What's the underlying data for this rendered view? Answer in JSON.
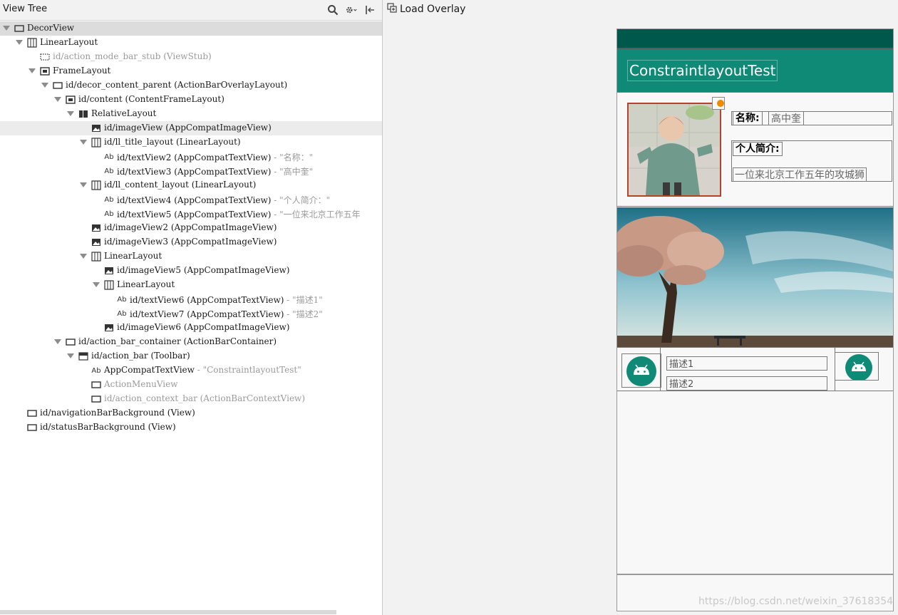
{
  "tree_panel": {
    "title": "View Tree",
    "icons": [
      "search-icon",
      "gear-icon",
      "collapse-icon"
    ]
  },
  "rows": [
    {
      "name": "DecorView",
      "id": "",
      "suffix": "",
      "icon": "frame",
      "arrow": true,
      "dim": false
    },
    {
      "name": "LinearLayout",
      "id": "",
      "suffix": "",
      "icon": "linear",
      "arrow": true,
      "dim": false
    },
    {
      "name": "id/action_mode_bar_stub (ViewStub)",
      "id": "",
      "suffix": "",
      "icon": "stub",
      "arrow": false,
      "dim": true
    },
    {
      "name": "FrameLayout",
      "id": "",
      "suffix": "",
      "icon": "framelayout",
      "arrow": true,
      "dim": false
    },
    {
      "name": "id/decor_content_parent (ActionBarOverlayLayout)",
      "id": "",
      "suffix": "",
      "icon": "frame",
      "arrow": true,
      "dim": false
    },
    {
      "name": "id/content (ContentFrameLayout)",
      "id": "",
      "suffix": "",
      "icon": "framelayout",
      "arrow": true,
      "dim": false
    },
    {
      "name": "RelativeLayout",
      "id": "",
      "suffix": "",
      "icon": "relative",
      "arrow": true,
      "dim": false
    },
    {
      "name": "id/imageView (AppCompatImageView)",
      "id": "",
      "suffix": "",
      "icon": "image",
      "arrow": false,
      "dim": false
    },
    {
      "name": "id/ll_title_layout (LinearLayout)",
      "id": "",
      "suffix": "",
      "icon": "linear",
      "arrow": true,
      "dim": false
    },
    {
      "name": "id/textView2 (AppCompatTextView)",
      "id": "",
      "suffix": " - \"名称：\"",
      "icon": "text",
      "arrow": false,
      "dim": false
    },
    {
      "name": "id/textView3 (AppCompatTextView)",
      "id": "",
      "suffix": " - \"高中奎\"",
      "icon": "text",
      "arrow": false,
      "dim": false
    },
    {
      "name": "id/ll_content_layout (LinearLayout)",
      "id": "",
      "suffix": "",
      "icon": "linear",
      "arrow": true,
      "dim": false
    },
    {
      "name": "id/textView4 (AppCompatTextView)",
      "id": "",
      "suffix": " - \"个人简介：\"",
      "icon": "text",
      "arrow": false,
      "dim": false
    },
    {
      "name": "id/textView5 (AppCompatTextView)",
      "id": "",
      "suffix": " - \"一位来北京工作五年",
      "icon": "text",
      "arrow": false,
      "dim": false
    },
    {
      "name": "id/imageView2 (AppCompatImageView)",
      "id": "",
      "suffix": "",
      "icon": "image",
      "arrow": false,
      "dim": false
    },
    {
      "name": "id/imageView3 (AppCompatImageView)",
      "id": "",
      "suffix": "",
      "icon": "image",
      "arrow": false,
      "dim": false
    },
    {
      "name": "LinearLayout",
      "id": "",
      "suffix": "",
      "icon": "linear",
      "arrow": true,
      "dim": false
    },
    {
      "name": "id/imageView5 (AppCompatImageView)",
      "id": "",
      "suffix": "",
      "icon": "image",
      "arrow": false,
      "dim": false
    },
    {
      "name": "LinearLayout",
      "id": "",
      "suffix": "",
      "icon": "linear",
      "arrow": true,
      "dim": false
    },
    {
      "name": "id/textView6 (AppCompatTextView)",
      "id": "",
      "suffix": " - \"描述1\"",
      "icon": "text",
      "arrow": false,
      "dim": false
    },
    {
      "name": "id/textView7 (AppCompatTextView)",
      "id": "",
      "suffix": " - \"描述2\"",
      "icon": "text",
      "arrow": false,
      "dim": false
    },
    {
      "name": "id/imageView6 (AppCompatImageView)",
      "id": "",
      "suffix": "",
      "icon": "image",
      "arrow": false,
      "dim": false
    },
    {
      "name": "id/action_bar_container (ActionBarContainer)",
      "id": "",
      "suffix": "",
      "icon": "frame",
      "arrow": true,
      "dim": false
    },
    {
      "name": "id/action_bar (Toolbar)",
      "id": "",
      "suffix": "",
      "icon": "toolbar",
      "arrow": true,
      "dim": false
    },
    {
      "name": "AppCompatTextView",
      "id": "",
      "suffix": " - \"ConstraintlayoutTest\"",
      "icon": "text",
      "arrow": false,
      "dim": false
    },
    {
      "name": "ActionMenuView",
      "id": "",
      "suffix": "",
      "icon": "frame",
      "arrow": false,
      "dim": true
    },
    {
      "name": "id/action_context_bar (ActionBarContextView)",
      "id": "",
      "suffix": "",
      "icon": "frame",
      "arrow": false,
      "dim": true
    },
    {
      "name": "id/navigationBarBackground (View)",
      "id": "",
      "suffix": "",
      "icon": "frame",
      "arrow": false,
      "dim": false
    },
    {
      "name": "id/statusBarBackground (View)",
      "id": "",
      "suffix": "",
      "icon": "frame",
      "arrow": false,
      "dim": false
    }
  ],
  "right_panel": {
    "load_overlay": "Load Overlay"
  },
  "device": {
    "app_title": "ConstraintlayoutTest",
    "name_label": "名称:",
    "name_value": "高中奎",
    "intro_label": "个人简介:",
    "intro_value": "一位来北京工作五年的攻城狮",
    "desc1": "描述1",
    "desc2": "描述2",
    "colors": {
      "status_bar": "#00574b",
      "action_bar": "#0f8a76",
      "android_icon": "#0f8a76"
    }
  },
  "watermark": "https://blog.csdn.net/weixin_37618354"
}
